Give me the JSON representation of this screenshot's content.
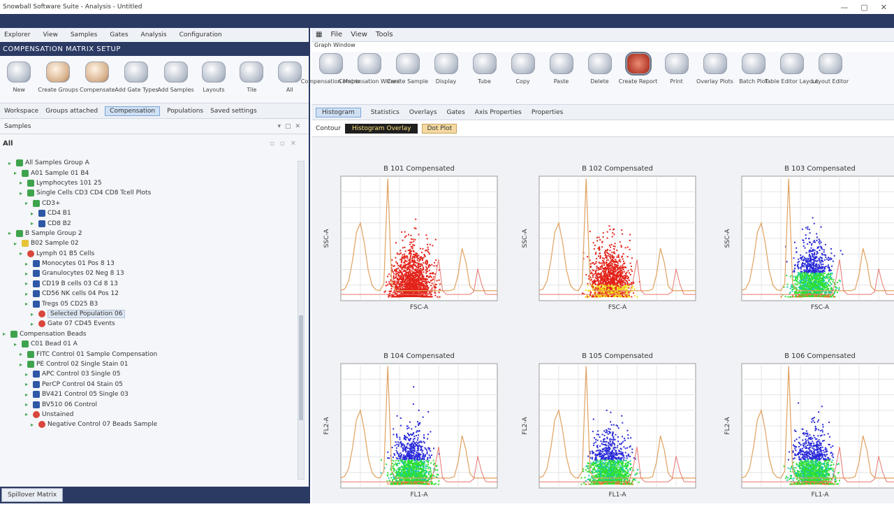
{
  "window": {
    "title": "Snowball Software Suite - Analysis - Untitled",
    "controls": [
      "—",
      "▢",
      "✕"
    ]
  },
  "left": {
    "menu": [
      "Explorer",
      "View",
      "Samples",
      "Gates",
      "Analysis",
      "Configuration"
    ],
    "header": "COMPENSATION MATRIX SETUP",
    "ribbon": [
      {
        "label": "New",
        "icon": "sample-tube-icon",
        "warm": false
      },
      {
        "label": "Create Groups",
        "icon": "cell-cluster-icon",
        "warm": true
      },
      {
        "label": "Compensate",
        "icon": "flask-icon",
        "warm": true
      },
      {
        "label": "Add Gate Types",
        "icon": "gate-icon",
        "warm": false
      },
      {
        "label": "Add Samples",
        "icon": "sample-icon",
        "warm": false
      },
      {
        "label": "Layouts",
        "icon": "layout-icon",
        "warm": false
      },
      {
        "label": "Tile",
        "icon": "tile-icon",
        "warm": false
      },
      {
        "label": "All",
        "icon": "window-icon",
        "warm": false
      }
    ],
    "toolbar": [
      "Workspace",
      "Groups attached",
      "Populations",
      "Saved settings"
    ],
    "toolbar_highlight": "Compensation",
    "panel_title": "Samples",
    "sub_title": "All",
    "tree": [
      {
        "indent": 1,
        "glyph": "green",
        "text": "All Samples Group A"
      },
      {
        "indent": 2,
        "glyph": "green",
        "text": "A01 Sample 01 B4"
      },
      {
        "indent": 3,
        "glyph": "green",
        "text": "Lymphocytes 101 25"
      },
      {
        "indent": 3,
        "glyph": "green",
        "text": "Single Cells CD3 CD4 CD8 Tcell Plots"
      },
      {
        "indent": 4,
        "glyph": "green",
        "text": "CD3+"
      },
      {
        "indent": 5,
        "glyph": "blue",
        "text": "CD4 B1"
      },
      {
        "indent": 5,
        "glyph": "blue",
        "text": "CD8 B2"
      },
      {
        "indent": 1,
        "glyph": "green",
        "text": "B Sample Group 2"
      },
      {
        "indent": 2,
        "glyph": "yellow",
        "text": "B02 Sample 02"
      },
      {
        "indent": 3,
        "glyph": "red",
        "text": "Lymph 01 B5 Cells"
      },
      {
        "indent": 4,
        "glyph": "blue",
        "text": "Monocytes 01 Pos 8 13"
      },
      {
        "indent": 4,
        "glyph": "blue",
        "text": "Granulocytes 02 Neg 8 13"
      },
      {
        "indent": 4,
        "glyph": "blue",
        "text": "CD19 B cells 03 Cd 8 13"
      },
      {
        "indent": 4,
        "glyph": "blue",
        "text": "CD56 NK cells 04 Pos 12"
      },
      {
        "indent": 4,
        "glyph": "blue",
        "text": "Tregs 05 CD25 B3"
      },
      {
        "indent": 5,
        "glyph": "red",
        "text": "Selected Population 06",
        "selected": true
      },
      {
        "indent": 5,
        "glyph": "red",
        "text": "Gate 07 CD45 Events"
      },
      {
        "indent": 0,
        "glyph": "green",
        "text": "Compensation Beads"
      },
      {
        "indent": 2,
        "glyph": "green",
        "text": "C01 Bead 01 A"
      },
      {
        "indent": 3,
        "glyph": "green",
        "text": "FITC Control 01 Sample Compensation"
      },
      {
        "indent": 3,
        "glyph": "green",
        "text": "PE Control 02 Single Stain 01"
      },
      {
        "indent": 4,
        "glyph": "blue",
        "text": "APC Control 03 Single 05"
      },
      {
        "indent": 4,
        "glyph": "blue",
        "text": "PerCP Control 04 Stain 05"
      },
      {
        "indent": 4,
        "glyph": "blue",
        "text": "BV421 Control 05 Single 03"
      },
      {
        "indent": 4,
        "glyph": "blue",
        "text": "BV510 06 Control"
      },
      {
        "indent": 4,
        "glyph": "red",
        "text": "Unstained"
      },
      {
        "indent": 5,
        "glyph": "red",
        "text": "Negative Control 07 Beads Sample"
      }
    ],
    "status_tab": "Spillover Matrix"
  },
  "right": {
    "menu": [
      "File",
      "View",
      "Tools"
    ],
    "ribbon_label": "Graph Window",
    "ribbon": [
      {
        "label": "Compensation Matrix",
        "icon": "cylinder-icon"
      },
      {
        "label": "Compensation Wizard",
        "icon": "document-icon"
      },
      {
        "label": "Create Sample",
        "icon": "page-icon"
      },
      {
        "label": "Display",
        "icon": "jar-icon"
      },
      {
        "label": "Tube",
        "icon": "tube-icon"
      },
      {
        "label": "Copy",
        "icon": "copy-icon"
      },
      {
        "label": "Paste",
        "icon": "paste-icon"
      },
      {
        "label": "Delete",
        "icon": "delete-icon"
      },
      {
        "label": "Create Report",
        "icon": "report-icon",
        "active": true
      },
      {
        "label": "Print",
        "icon": "print-icon"
      },
      {
        "label": "Overlay Plots",
        "icon": "overlay-icon"
      },
      {
        "label": "Batch Plot",
        "icon": "batch-icon"
      },
      {
        "label": "Table Editor Layout",
        "icon": "table-icon"
      },
      {
        "label": "Layout Editor",
        "icon": "editor-icon"
      }
    ],
    "toolbar_highlight": "Histogram",
    "toolbar": [
      "Statistics",
      "Overlays",
      "Gates",
      "Axis Properties",
      "Properties"
    ],
    "tabs": {
      "label": "Contour",
      "dark": "Histogram Overlay",
      "tan": "Dot Plot"
    },
    "plots": [
      {
        "title": "B 101 Compensated",
        "xlabel": "FSC-A",
        "ylabel": "SSC-A",
        "scheme": "red"
      },
      {
        "title": "B 102 Compensated",
        "xlabel": "FSC-A",
        "ylabel": "SSC-A",
        "scheme": "redyellow"
      },
      {
        "title": "B 103 Compensated",
        "xlabel": "FSC-A",
        "ylabel": "SSC-A",
        "scheme": "bluegreen"
      },
      {
        "title": "B 104 Compensated",
        "xlabel": "FL1-A",
        "ylabel": "FL2-A",
        "scheme": "bluegreen2"
      },
      {
        "title": "B 105 Compensated",
        "xlabel": "FL1-A",
        "ylabel": "FL2-A",
        "scheme": "bluegreen3"
      },
      {
        "title": "B 106 Compensated",
        "xlabel": "FL1-A",
        "ylabel": "FL2-A",
        "scheme": "bluegreen4"
      }
    ],
    "colors": {
      "navy": "#2b3a63",
      "red": "#e2231a",
      "blue": "#2a2ad9",
      "green": "#2ee02e",
      "yellow": "#f4e11a",
      "orange": "#e07a2f"
    }
  }
}
